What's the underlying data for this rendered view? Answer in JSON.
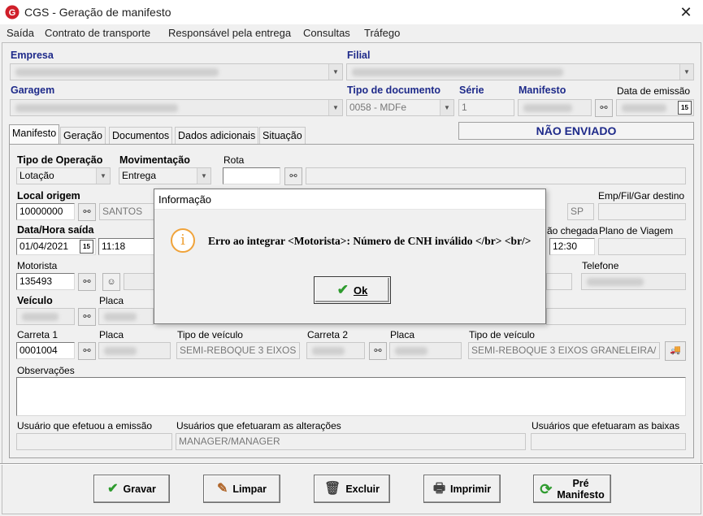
{
  "window": {
    "title": "CGS - Geração de manifesto",
    "close": "✕"
  },
  "menu": [
    "Saída",
    "Contrato de transporte",
    "Responsável pela entrega",
    "Consultas",
    "Tráfego"
  ],
  "header": {
    "empresa_label": "Empresa",
    "filial_label": "Filial",
    "garagem_label": "Garagem",
    "tipo_doc_label": "Tipo de documento",
    "tipo_doc_value": "0058 - MDFe",
    "serie_label": "Série",
    "serie_value": "1",
    "manifesto_label": "Manifesto",
    "data_emissao_label": "Data de emissão",
    "status": "NÃO ENVIADO"
  },
  "tabs": [
    "Manifesto",
    "Geração",
    "Documentos",
    "Dados adicionais",
    "Situação"
  ],
  "manifesto": {
    "tipo_operacao_label": "Tipo de Operação",
    "tipo_operacao_value": "Lotação",
    "movimentacao_label": "Movimentação",
    "movimentacao_value": "Entrega",
    "rota_label": "Rota",
    "local_origem_label": "Local origem",
    "local_origem_code": "10000000",
    "local_origem_city": "SANTOS",
    "uf_value": "SP",
    "emp_destino_label": "Emp/Fil/Gar destino",
    "data_hora_label": "Data/Hora saída",
    "data_value": "01/04/2021",
    "hora_value": "11:18",
    "chegada_label": "ão chegada",
    "chegada_value": "12:30",
    "plano_label": "Plano de Viagem",
    "motorista_label": "Motorista",
    "motorista_value": "135493",
    "telefone_label": "Telefone",
    "veiculo_label": "Veículo",
    "placa_label": "Placa",
    "carreta1_label": "Carreta 1",
    "carreta1_value": "0001004",
    "placa2_label": "Placa",
    "tipo_veiculo_label": "Tipo de veículo",
    "tipo_veiculo1_value": "SEMI-REBOQUE 3 EIXOS",
    "carreta2_label": "Carreta 2",
    "placa3_label": "Placa",
    "tipo_veiculo2_label": "Tipo de veículo",
    "tipo_veiculo2_value": "SEMI-REBOQUE 3 EIXOS GRANELEIRA/",
    "observacoes_label": "Observações",
    "usuario_emissao_label": "Usuário que efetuou a emissão",
    "usuarios_alteracoes_label": "Usuários que efetuaram as alterações",
    "usuarios_alteracoes_value": "MANAGER/MANAGER",
    "usuarios_baixas_label": "Usuários que efetuaram as baixas"
  },
  "dialog": {
    "title": "Informação",
    "message": "Erro ao integrar <Motorista>: Número de CNH inválido </br> <br/>",
    "ok_label": "Ok"
  },
  "buttons": {
    "gravar": "Gravar",
    "limpar": "Limpar",
    "excluir": "Excluir",
    "imprimir": "Imprimir",
    "pre": "Pré",
    "manifesto": "Manifesto"
  },
  "colors": {
    "label_blue": "#1e2a8a",
    "info_orange": "#f0a33a",
    "check_green": "#2e9b2e"
  }
}
